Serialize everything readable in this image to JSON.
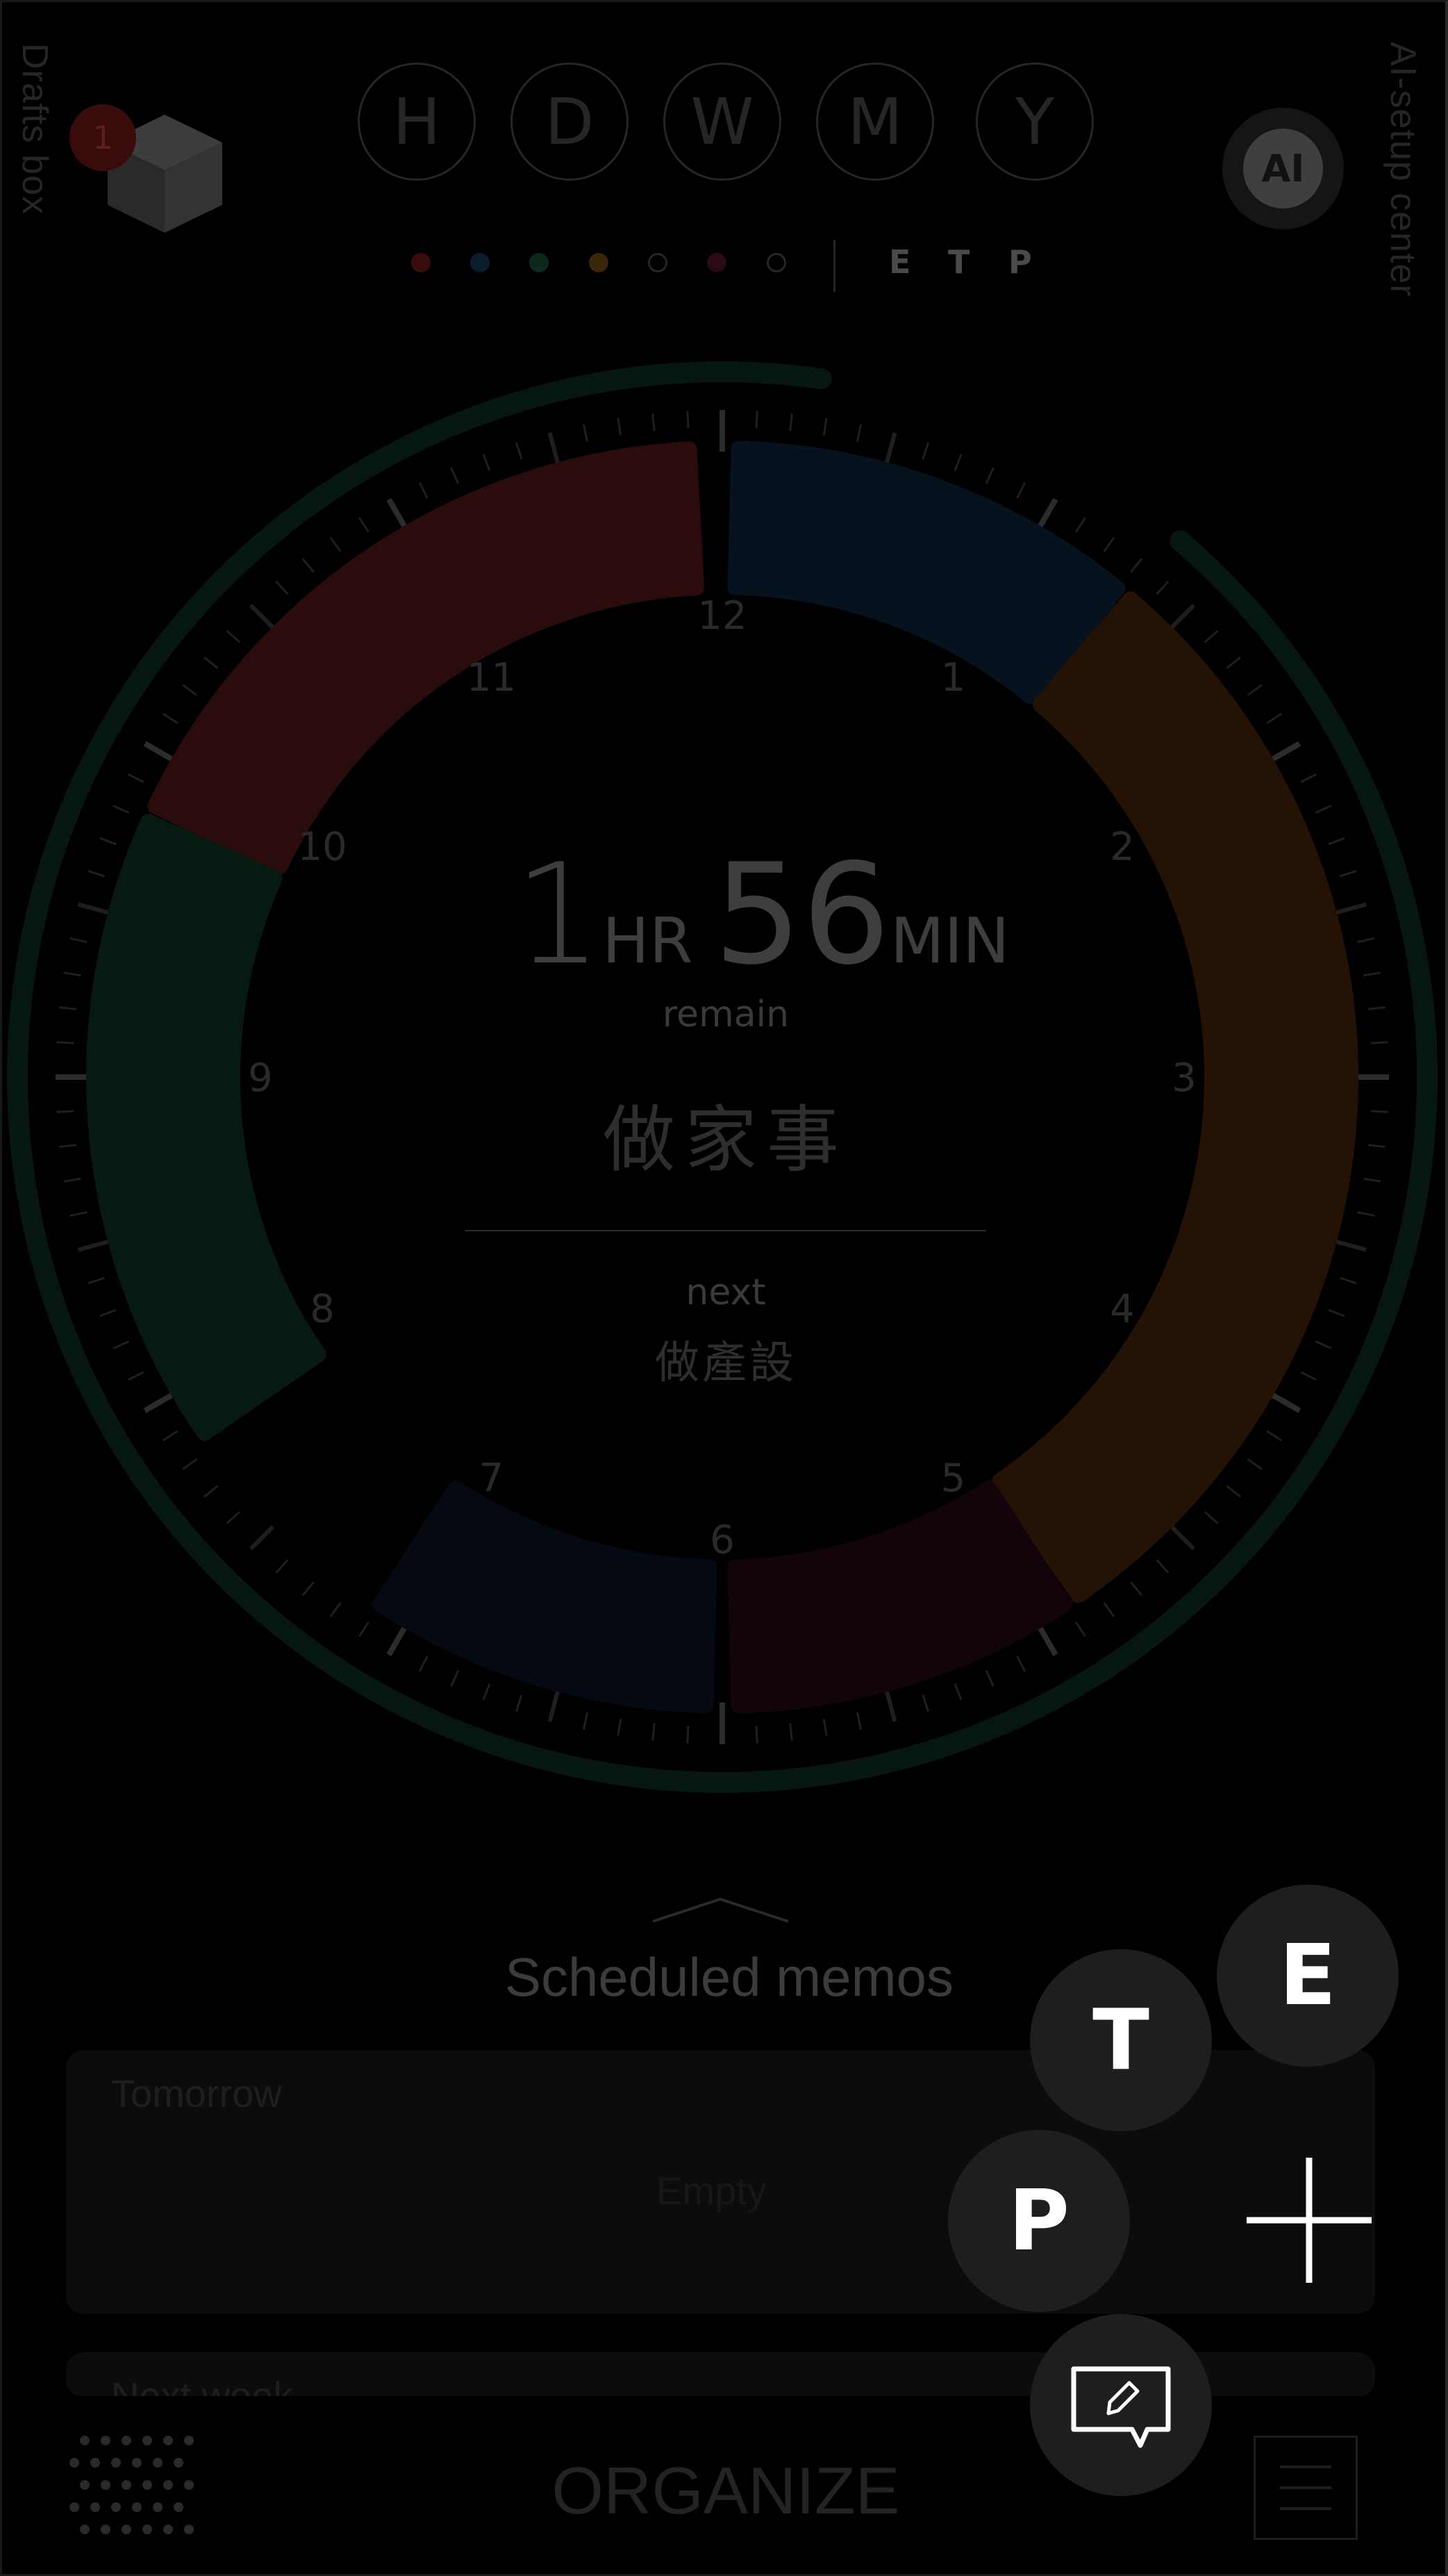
{
  "drafts_box": {
    "label": "Drafts box",
    "badge": "1"
  },
  "ai_setup": {
    "label": "AI-setup center",
    "button_label": "AI"
  },
  "periods": [
    "H",
    "D",
    "W",
    "M",
    "Y"
  ],
  "filter_colors": [
    "#3a0d0d",
    "#0b1c2e",
    "#0b2a1c",
    "#3a2608",
    "#1a1a1a",
    "#2a0b14",
    "#1a1a1a"
  ],
  "filter_modes": [
    "E",
    "T",
    "P"
  ],
  "clock": {
    "hour_labels": [
      "12",
      "1",
      "2",
      "3",
      "4",
      "5",
      "6",
      "7",
      "8",
      "9",
      "10",
      "11"
    ],
    "remaining_hours": "1",
    "hr_unit": "HR",
    "remaining_minutes": "56",
    "min_unit": "MIN",
    "remain_label": "remain",
    "current_task": "做家事",
    "next_label": "next",
    "next_task": "做產設",
    "progress_fraction": 0.91,
    "segment_colors": {
      "red": "#2a0c0c",
      "blue": "#06131f",
      "orange": "#241304",
      "crimson": "#12040a",
      "navy": "#050912",
      "green": "#061a11"
    }
  },
  "scheduled": {
    "title": "Scheduled memos",
    "cards": [
      {
        "label": "Tomorrow",
        "content": "Empty"
      },
      {
        "label": "Next week",
        "content": ""
      }
    ]
  },
  "bottom": {
    "title": "ORGANIZE"
  },
  "fab": {
    "e": "E",
    "t": "T",
    "p": "P"
  }
}
